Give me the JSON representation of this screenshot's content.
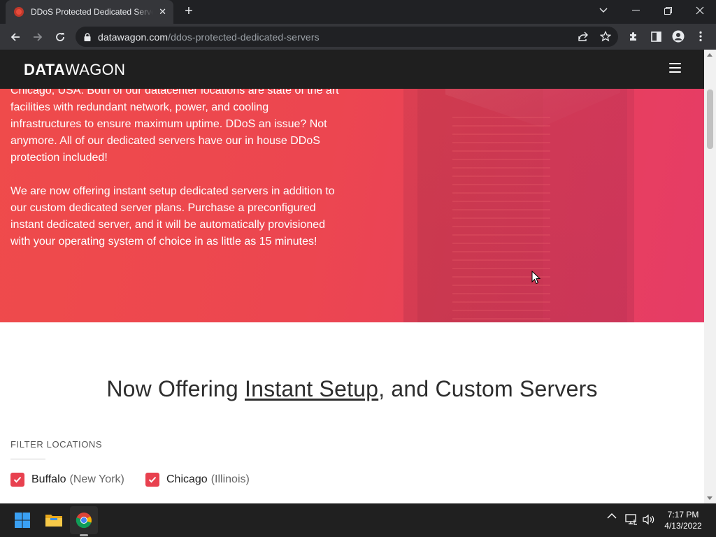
{
  "browser": {
    "tab_title": "DDoS Protected Dedicated Servers",
    "url_domain": "datawagon.com",
    "url_path": "/ddos-protected-dedicated-servers"
  },
  "site": {
    "logo_bold": "DATA",
    "logo_light": "WAGON"
  },
  "hero": {
    "paragraph1": "Chicago, USA. Both of our datacenter locations are state of the art facilities with redundant network, power, and cooling infrastructures to ensure maximum uptime. DDoS an issue? Not anymore. All of our dedicated servers have our in house DDoS protection included!",
    "paragraph2": "We are now offering instant setup dedicated servers in addition to our custom dedicated server plans. Purchase a preconfigured instant dedicated server, and it will be automatically provisioned with your operating system of choice in as little as 15 minutes!"
  },
  "offering": {
    "title_part1": "Now Offering ",
    "title_link": "Instant Setup",
    "title_part2": ", and Custom Servers"
  },
  "filter": {
    "label": "FILTER LOCATIONS",
    "locations": [
      {
        "name": "Buffalo",
        "region": "(New York)",
        "checked": true
      },
      {
        "name": "Chicago",
        "region": "(Illinois)",
        "checked": true
      }
    ]
  },
  "taskbar": {
    "time": "7:17 PM",
    "date": "4/13/2022"
  },
  "colors": {
    "accent": "#e8414f",
    "header_bg": "#1f1f1f"
  }
}
